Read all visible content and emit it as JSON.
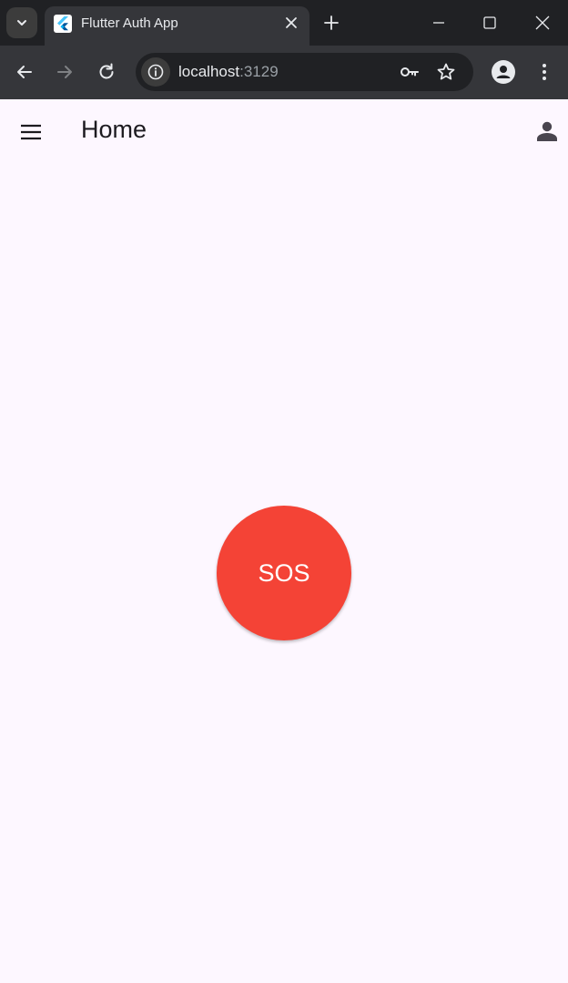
{
  "browser": {
    "tab": {
      "title": "Flutter Auth App"
    },
    "address_bar": {
      "host": "localhost",
      "port": ":3129"
    }
  },
  "app": {
    "app_bar": {
      "title": "Home"
    },
    "sos_button": {
      "label": "SOS",
      "color": "#f44336"
    },
    "background_color": "#fdf7ff"
  }
}
